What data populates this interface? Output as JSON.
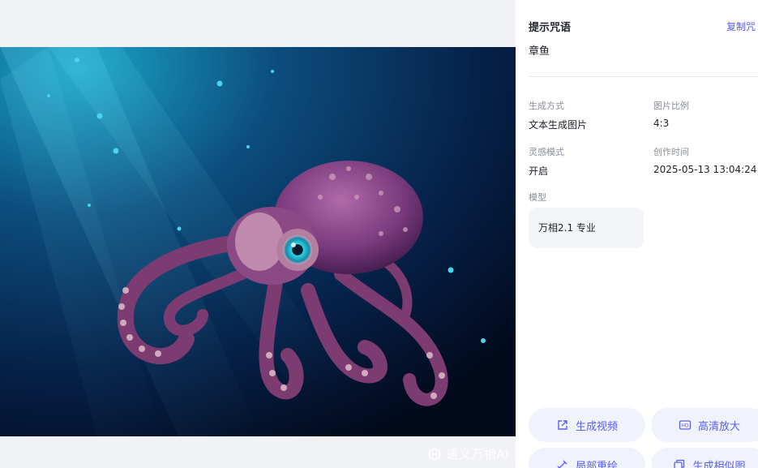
{
  "watermark": {
    "text": "通义万相AI",
    "icon": "tongyi-logo-icon"
  },
  "prompt": {
    "title": "提示咒语",
    "copy_label": "复制咒",
    "text": "章鱼"
  },
  "meta": [
    {
      "label": "生成方式",
      "value": "文本生成图片"
    },
    {
      "label": "图片比例",
      "value": "4:3"
    },
    {
      "label": "灵感模式",
      "value": "开启"
    },
    {
      "label": "创作时间",
      "value": "2025-05-13 13:04:24"
    }
  ],
  "model": {
    "label": "模型",
    "value": "万相2.1 专业"
  },
  "actions": [
    {
      "label": "生成视频",
      "icon": "share-video-icon"
    },
    {
      "label": "高清放大",
      "icon": "hd-icon"
    },
    {
      "label": "局部重绘",
      "icon": "brush-icon"
    },
    {
      "label": "生成相似图",
      "icon": "copy-image-icon"
    }
  ],
  "colors": {
    "accent": "#5b5ff0",
    "panel_bg": "#ffffff",
    "chip_bg": "#f4f5f9",
    "action_bg": "#f0f3fc"
  }
}
